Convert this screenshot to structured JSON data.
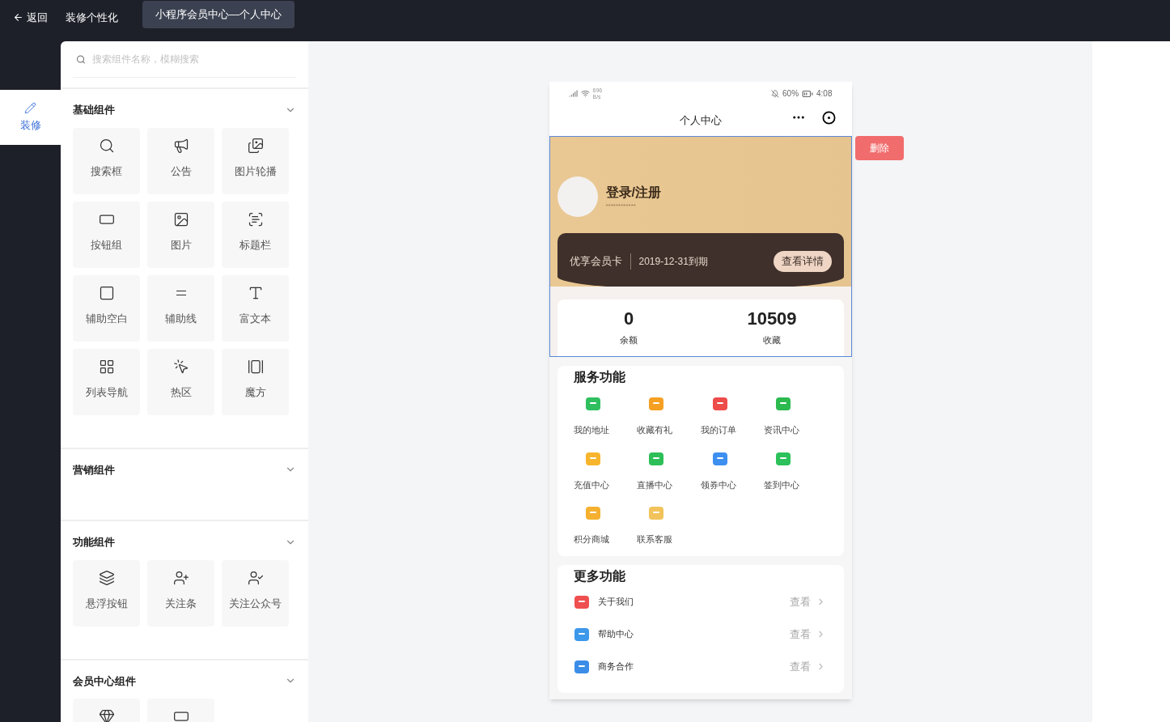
{
  "top_bar": {
    "back": "返回",
    "title": "装修个性化",
    "tabs": [
      {
        "label": "小程序会员中心—个人中心",
        "selected": true
      }
    ]
  },
  "rail": {
    "items": [
      {
        "label": "装修",
        "selected": true
      }
    ]
  },
  "panel": {
    "search": {
      "placeholder": "搜索组件名称，模糊搜索"
    },
    "groups": [
      {
        "title": "基础组件",
        "items": [
          {
            "kind": "labeled",
            "label": "搜索框"
          },
          {
            "kind": "labeled",
            "label": "公告"
          },
          {
            "kind": "labeled",
            "label": "图片轮播"
          },
          {
            "kind": "labeled",
            "label": "按钮组"
          },
          {
            "kind": "labeled",
            "label": "图片"
          },
          {
            "kind": "labeled",
            "label": "标题栏"
          },
          {
            "kind": "labeled",
            "label": "辅助空白"
          },
          {
            "kind": "labeled",
            "label": "辅助线"
          },
          {
            "kind": "labeled",
            "label": "富文本"
          },
          {
            "kind": "labeled",
            "label": "列表导航"
          },
          {
            "kind": "labeled",
            "label": "热区"
          },
          {
            "kind": "labeled",
            "label": "魔方"
          }
        ]
      },
      {
        "title": "营销组件"
      },
      {
        "title": "功能组件",
        "items": [
          {
            "kind": "labeled",
            "label": "悬浮按钮"
          },
          {
            "kind": "labeled",
            "label": "关注条"
          },
          {
            "kind": "labeled",
            "label": "关注公众号"
          }
        ]
      },
      {
        "title": "会员中心组件",
        "items": [
          {
            "kind": "icon_only"
          },
          {
            "kind": "icon_only"
          }
        ]
      }
    ]
  },
  "phone": {
    "status_bar": {
      "speed": "696 B/s",
      "battery": "60%",
      "time": "4:08"
    },
    "nav_title": "个人中心",
    "hero": {
      "selected": true,
      "delete": "删除",
      "name": "登录/注册",
      "subtitle": "************",
      "card_name": "优享会员卡",
      "expiry": "2019-12-31到期",
      "details": "查看详情",
      "stats": [
        {
          "value": "0",
          "label": "余额"
        },
        {
          "value": "10509",
          "label": "收藏"
        }
      ]
    },
    "services": {
      "title": "服务功能",
      "items": [
        {
          "label": "我的地址",
          "color": "#2fbf5f"
        },
        {
          "label": "收藏有礼",
          "color": "#f5a023"
        },
        {
          "label": "我的订单",
          "color": "#ee4b4b"
        },
        {
          "label": "资讯中心",
          "color": "#2cba4f"
        },
        {
          "label": "充值中心",
          "color": "#f7b52c"
        },
        {
          "label": "直播中心",
          "color": "#2cbf57"
        },
        {
          "label": "领券中心",
          "color": "#3d8ff0"
        },
        {
          "label": "签到中心",
          "color": "#2cc15a"
        },
        {
          "label": "积分商城",
          "color": "#f5b02f"
        },
        {
          "label": "联系客服",
          "color": "#f1c35a"
        }
      ]
    },
    "more": {
      "title": "更多功能",
      "items": [
        {
          "label": "关于我们",
          "action": "查看",
          "color": "#ef4f4f"
        },
        {
          "label": "帮助中心",
          "action": "查看",
          "color": "#3c98ea"
        },
        {
          "label": "商务合作",
          "action": "查看",
          "color": "#3b8de8"
        }
      ]
    }
  }
}
